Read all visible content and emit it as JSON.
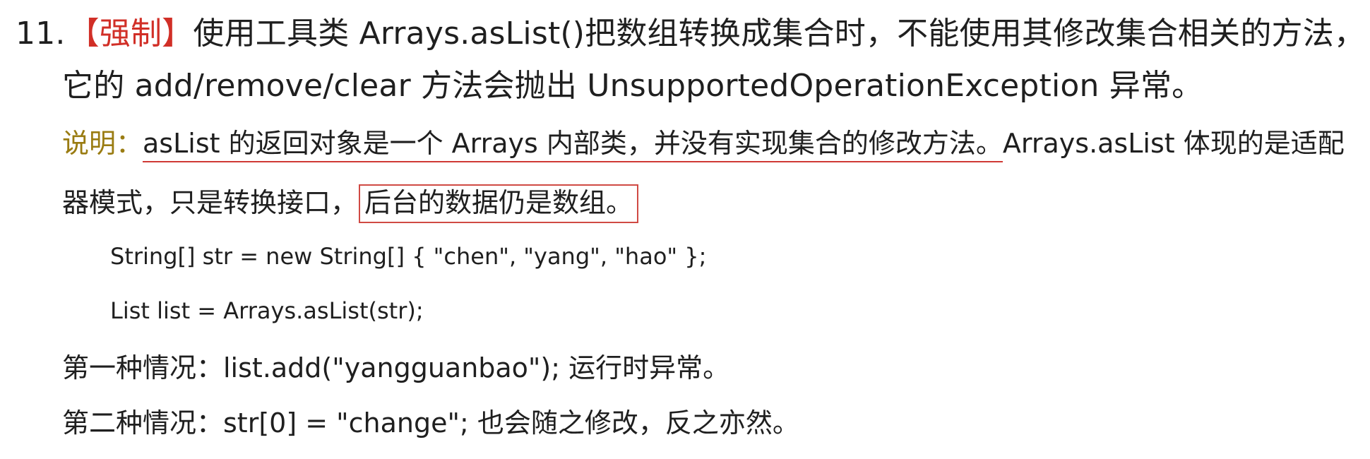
{
  "rule": {
    "number": "11.",
    "tag": "【强制】",
    "line1": "使用工具类 Arrays.asList()把数组转换成集合时，不能使用其修改集合相关的方法，",
    "line2": "它的 add/remove/clear 方法会抛出 UnsupportedOperationException 异常。",
    "note_label": "说明：",
    "note_underlined": "asList 的返回对象是一个 Arrays 内部类，并没有实现集合的修改方法。",
    "note_rest": "Arrays.asList 体现的是适配",
    "note_line2_prefix": "器模式，只是转换接口，",
    "note_boxed": "后台的数据仍是数组。",
    "code_lines": [
      "String[] str = new String[] { \"chen\", \"yang\", \"hao\" };",
      "List list = Arrays.asList(str);"
    ],
    "cases": [
      "第一种情况：list.add(\"yangguanbao\");  运行时异常。",
      "第二种情况：str[0] = \"change\";  也会随之修改，反之亦然。"
    ]
  }
}
